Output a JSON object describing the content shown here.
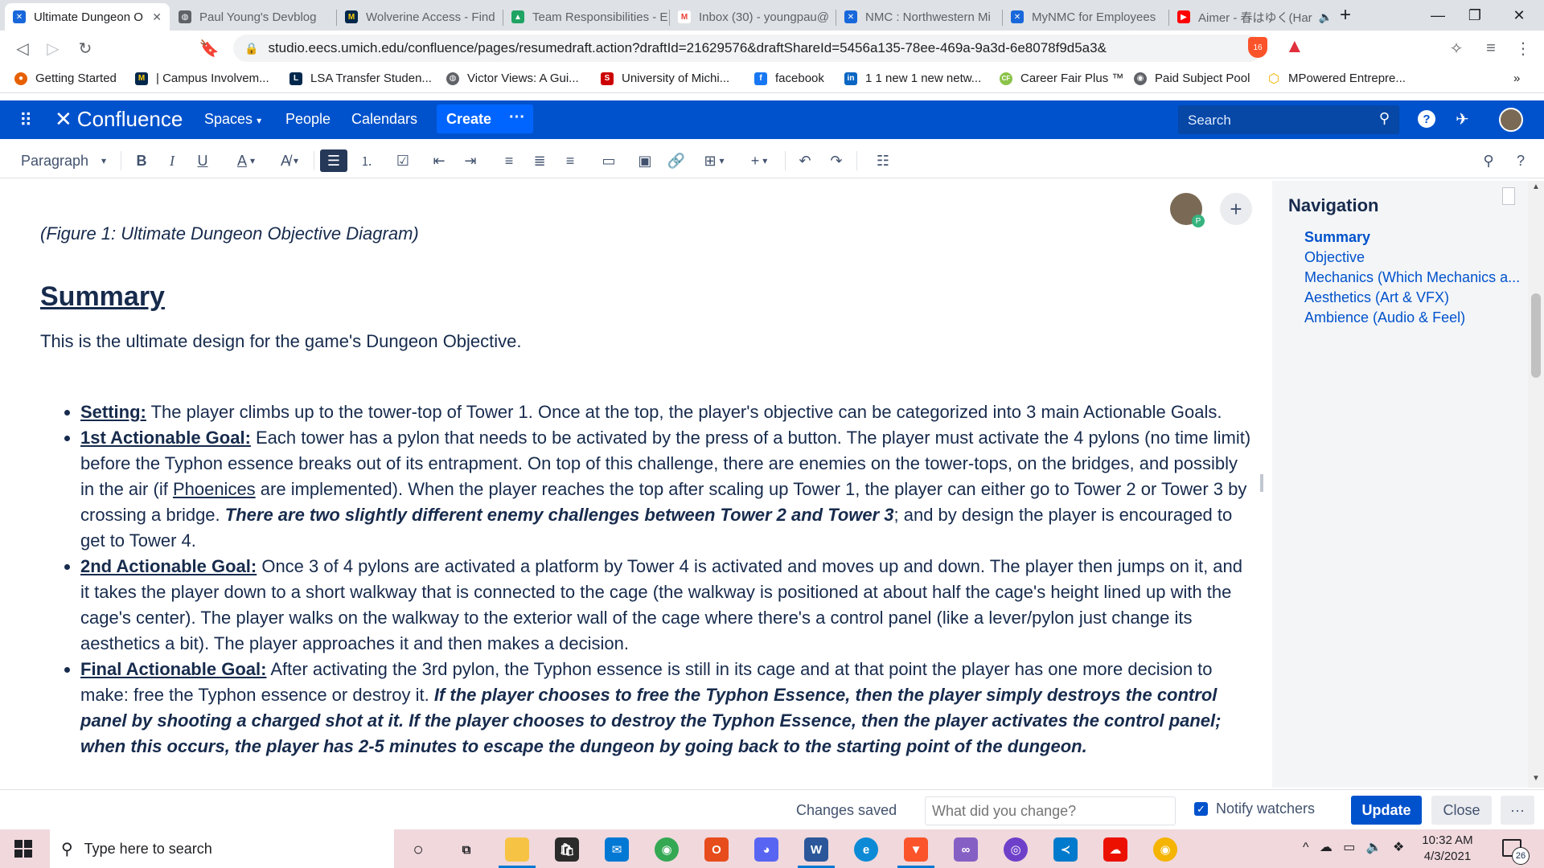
{
  "browser": {
    "tabs": [
      {
        "title": "Ultimate Dungeon O",
        "color": "#1868db",
        "glyph": "✕"
      },
      {
        "title": "Paul Young's Devblog",
        "color": "#5f6368",
        "glyph": "◍"
      },
      {
        "title": "Wolverine Access - Find",
        "color": "#00274c",
        "glyph": "M"
      },
      {
        "title": "Team Responsibilities - E",
        "color": "#1fa463",
        "glyph": "▲"
      },
      {
        "title": "Inbox (30) - youngpau@",
        "color": "#ea4335",
        "glyph": "M"
      },
      {
        "title": "NMC : Northwestern Mi",
        "color": "#1868db",
        "glyph": "✕"
      },
      {
        "title": "MyNMC for Employees",
        "color": "#1868db",
        "glyph": "✕"
      },
      {
        "title": "Aimer - 春はゆく(Har",
        "color": "#ff0000",
        "glyph": "▶"
      }
    ],
    "url": "studio.eecs.umich.edu/confluence/pages/resumedraft.action?draftId=21629576&draftShareId=5456a135-78ee-469a-9a3d-6e8078f9d5a3&",
    "brave_badge": "16",
    "bookmarks": [
      {
        "label": "Getting Started",
        "color": "#e66000",
        "glyph": "●"
      },
      {
        "label": "| Campus Involvem...",
        "color": "#00274c",
        "glyph": "M"
      },
      {
        "label": "LSA Transfer Studen...",
        "color": "#00274c",
        "glyph": "L"
      },
      {
        "label": "Victor Views: A Gui...",
        "color": "#5f6368",
        "glyph": "◍"
      },
      {
        "label": "University of Michi...",
        "color": "#c00",
        "glyph": "S"
      },
      {
        "label": "facebook",
        "color": "#1877f2",
        "glyph": "f"
      },
      {
        "label": "1 1 new 1 new netw...",
        "color": "#0a66c2",
        "glyph": "in"
      },
      {
        "label": "Career Fair Plus ™",
        "color": "#8bc34a",
        "glyph": "CF"
      },
      {
        "label": "Paid Subject Pool",
        "color": "#5f6368",
        "glyph": "◉"
      },
      {
        "label": "MPowered Entrepre...",
        "color": "#f4b400",
        "glyph": "⬡"
      }
    ]
  },
  "confluence": {
    "logo": "Confluence",
    "nav": [
      "Spaces",
      "People",
      "Calendars"
    ],
    "create_label": "Create",
    "more_label": "···",
    "search_placeholder": "Search"
  },
  "editor": {
    "style_select": "Paragraph"
  },
  "document": {
    "figure_caption": "(Figure 1: Ultimate Dungeon Objective Diagram)",
    "heading": "Summary",
    "intro": "This is the ultimate design for the game's Dungeon Objective.",
    "setting_label": "Setting:",
    "setting_text": " The player climbs up to the tower-top of Tower 1. Once at the top, the player's objective can be categorized into 3 main Actionable Goals.",
    "goal1_label": "1st Actionable Goal:",
    "goal1_a": " Each tower has a pylon that needs to be activated by the press of a button. The player must activate the 4 pylons (no time limit) before the Typhon essence breaks out of its entrapment. On top of this challenge, there are enemies on the tower-tops, on the bridges, and possibly in the air (if ",
    "goal1_link": "Phoenices",
    "goal1_b": " are implemented). When the player reaches the top after scaling up Tower 1, the player can either go to Tower 2 or Tower 3 by crossing a bridge. ",
    "goal1_bold": "There are two slightly different enemy challenges between Tower 2 and Tower 3",
    "goal1_c": "; and by design the player is encouraged to get to Tower 4.",
    "goal2_label": "2nd Actionable Goal:",
    "goal2_text": " Once 3 of 4 pylons are activated a platform by Tower 4 is activated and moves up and down. The player then jumps on it, and it takes the player down to a short walkway that is connected to the cage (the walkway is positioned at about half the cage's height lined up with the cage's center). The player walks on the walkway to the exterior wall of the cage where there's a control panel (like a lever/pylon just change its aesthetics a bit). The player approaches it and then makes a decision.",
    "final_label": "Final Actionable Goal:",
    "final_text": " After activating the 3rd pylon, the Typhon essence is still in its cage and at that point the player has one more decision to make: free the Typhon essence or destroy it. ",
    "final_bold": "If the player chooses to free the Typhon Essence, then the player simply destroys the control panel by shooting a charged shot at it. If the player chooses to destroy the Typhon Essence, then the player activates the control panel; when this occurs, the player has 2-5 minutes to escape the dungeon by going back to the starting point of the dungeon."
  },
  "navigation": {
    "title": "Navigation",
    "items": [
      "Summary",
      "Objective",
      "Mechanics (Which Mechanics a...",
      "Aesthetics (Art & VFX)",
      "Ambience (Audio & Feel)"
    ]
  },
  "footer": {
    "status": "Changes saved",
    "change_placeholder": "What did you change?",
    "notify_label": "Notify watchers",
    "update_label": "Update",
    "close_label": "Close",
    "more_label": "···"
  },
  "taskbar": {
    "search_placeholder": "Type here to search",
    "time": "10:32 AM",
    "date": "4/3/2021",
    "notification_count": "26"
  }
}
